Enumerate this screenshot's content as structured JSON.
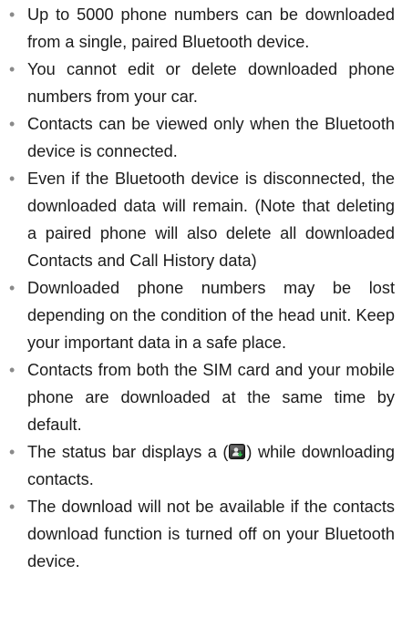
{
  "notes": [
    {
      "text": "Up to 5000 phone numbers can be downloaded from a single, paired Bluetooth device."
    },
    {
      "text": "You cannot edit or delete downloaded phone numbers from your car."
    },
    {
      "text": "Contacts can be viewed only when the Bluetooth device is connected."
    },
    {
      "text": "Even if the Bluetooth device is disconnected, the downloaded data will remain. (Note that deleting a paired phone will also delete all downloaded Contacts and Call History data)"
    },
    {
      "text": "Downloaded phone numbers may be lost depending on the condition of the head unit. Keep your important data in a safe place."
    },
    {
      "text": "Contacts from both the SIM card and your mobile phone are downloaded at the same time by default."
    },
    {
      "text_before": "The status bar displays a (",
      "icon": "contacts-download-status-icon",
      "text_after": ") while downloading contacts."
    },
    {
      "text": "The download will not be available if the contacts download function is turned off on your Bluetooth device."
    }
  ]
}
